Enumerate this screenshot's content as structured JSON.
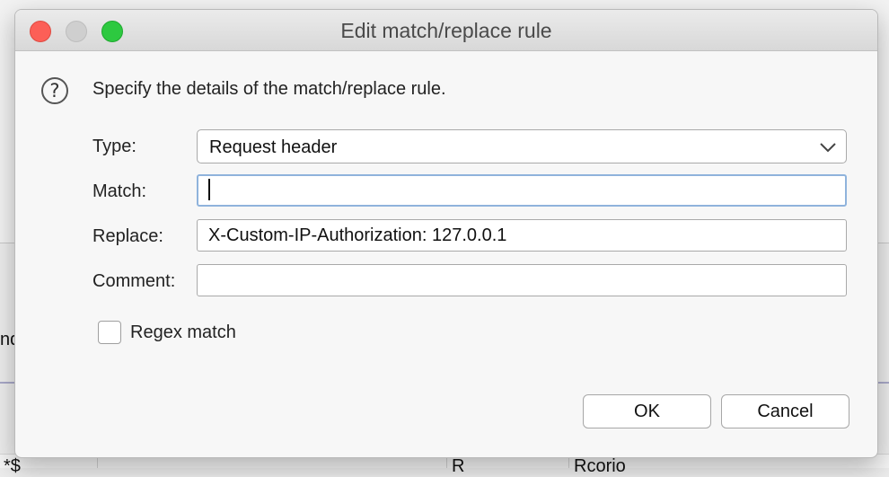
{
  "background": {
    "edge_text": "nd",
    "bottom_fragments": [
      "*$",
      "R",
      "Rcorio"
    ]
  },
  "dialog": {
    "title": "Edit match/replace rule",
    "help_icon": "question-circle-icon",
    "intro": "Specify the details of the match/replace rule.",
    "type": {
      "label": "Type:",
      "value": "Request header"
    },
    "match": {
      "label": "Match:",
      "value": ""
    },
    "replace": {
      "label": "Replace:",
      "value": "X-Custom-IP-Authorization: 127.0.0.1"
    },
    "comment": {
      "label": "Comment:",
      "value": ""
    },
    "regex": {
      "label": "Regex match",
      "checked": false
    },
    "buttons": {
      "ok": "OK",
      "cancel": "Cancel"
    }
  },
  "colors": {
    "close": "#fc5f57",
    "minimize_disabled": "#cfcfcf",
    "maximize": "#2dc940",
    "focus_ring": "#8fb3dc"
  }
}
